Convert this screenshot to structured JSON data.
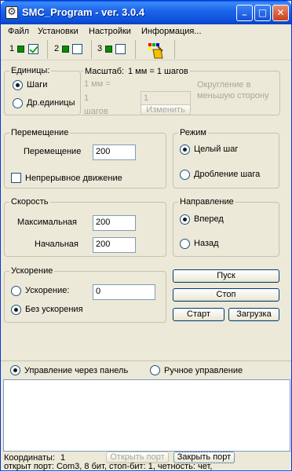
{
  "window": {
    "title": "SMC_Program - ver. 3.0.4",
    "minimize": "_",
    "maximize": "□",
    "close": "✕"
  },
  "menu": [
    "Файл",
    "Установки",
    "Настройки",
    "Информация..."
  ],
  "toolbar": {
    "channels": [
      {
        "num": "1",
        "checked": true
      },
      {
        "num": "2",
        "checked": false
      },
      {
        "num": "3",
        "checked": false
      }
    ],
    "tool_icon": "paint-tool-icon"
  },
  "units": {
    "label": "Единицы:",
    "steps": "Шаги",
    "other": "Др.единицы",
    "scale_label": "Масштаб:",
    "scale_value": "1 мм = 1 шагов",
    "mm_line": "1 мм =",
    "one": "1",
    "shagov": "шагов",
    "value": "1",
    "change_button": "Изменить",
    "rounding": "Округление в меньшую сторону"
  },
  "movement": {
    "title": "Перемещение",
    "field_label": "Перемещение",
    "field_value": "200",
    "continuous": "Непрерывное движение"
  },
  "mode": {
    "title": "Режим",
    "full": "Целый шаг",
    "micro": "Дробление шага"
  },
  "speed": {
    "title": "Скорость",
    "max_label": "Максимальная",
    "max_value": "200",
    "start_label": "Начальная",
    "start_value": "200"
  },
  "direction": {
    "title": "Направление",
    "forward": "Вперед",
    "back": "Назад"
  },
  "accel": {
    "title": "Ускорение",
    "with": "Ускорение:",
    "value": "0",
    "without": "Без ускорения"
  },
  "buttons": {
    "start_run": "Пуск",
    "stop": "Стоп",
    "start": "Старт",
    "load": "Загрузка"
  },
  "control": {
    "panel": "Управление через панель",
    "manual": "Ручное управление"
  },
  "status": {
    "coords_label": "Координаты:",
    "coords_value": "1",
    "open_port": "Открыть порт",
    "close_port": "Закрыть порт",
    "log_line": "открыт порт:  Com3, 8 бит, стоп-бит: 1, четность: чет,"
  },
  "colors": {
    "accent_green": "#21a121",
    "title_blue": "#0a4fd8"
  }
}
